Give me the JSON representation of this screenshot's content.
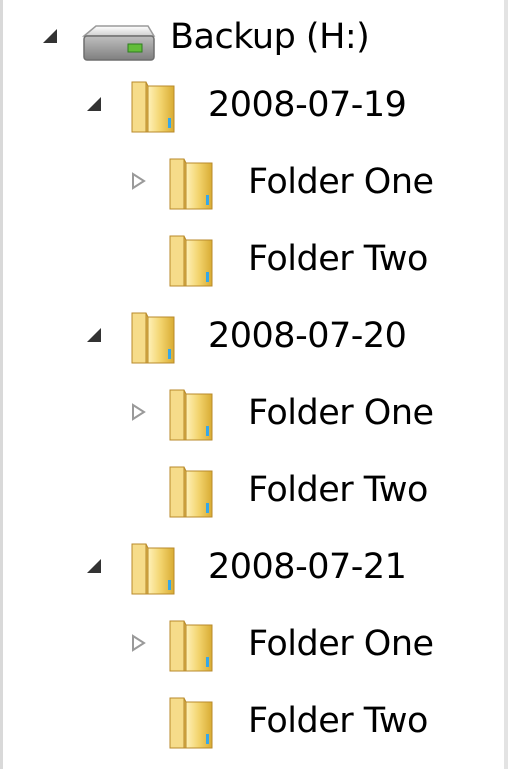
{
  "tree": {
    "root": {
      "label": "Backup (H:)",
      "icon": "drive-icon",
      "expanded": true
    },
    "dates": [
      {
        "label": "2008-07-19",
        "icon": "folder-icon",
        "expanded": true,
        "children": [
          {
            "label": "Folder One",
            "icon": "folder-icon",
            "has_children": true,
            "expanded": false
          },
          {
            "label": "Folder Two",
            "icon": "folder-icon",
            "has_children": false
          }
        ]
      },
      {
        "label": "2008-07-20",
        "icon": "folder-icon",
        "expanded": true,
        "children": [
          {
            "label": "Folder One",
            "icon": "folder-icon",
            "has_children": true,
            "expanded": false
          },
          {
            "label": "Folder Two",
            "icon": "folder-icon",
            "has_children": false
          }
        ]
      },
      {
        "label": "2008-07-21",
        "icon": "folder-icon",
        "expanded": true,
        "children": [
          {
            "label": "Folder One",
            "icon": "folder-icon",
            "has_children": true,
            "expanded": false
          },
          {
            "label": "Folder Two",
            "icon": "folder-icon",
            "has_children": false
          }
        ]
      }
    ]
  },
  "colors": {
    "folder_light": "#f7df82",
    "folder_dark": "#d9ac3a",
    "drive_body": "#9d9d9d",
    "drive_light": "#e8e8e8",
    "expanded_arrow": "#333333",
    "collapsed_arrow": "#9a9a9a",
    "text": "#000000"
  }
}
